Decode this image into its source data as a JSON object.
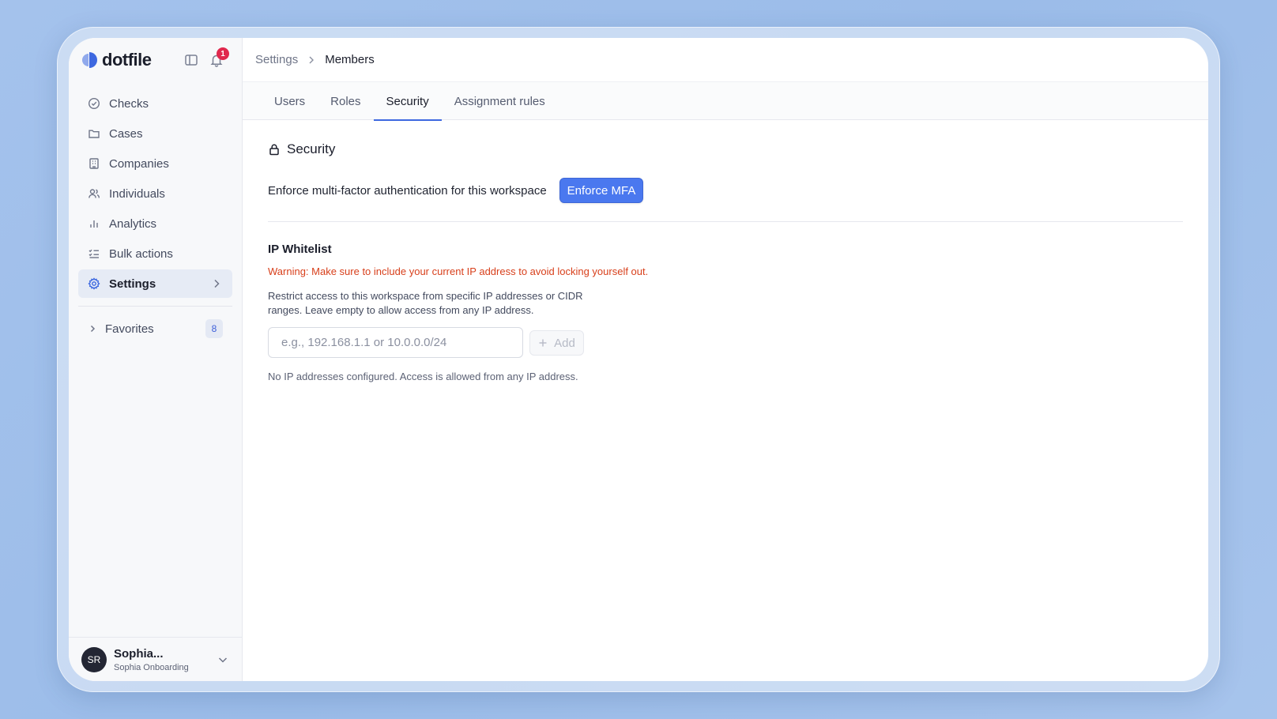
{
  "app": {
    "logo_text": "dotfile",
    "notification_count": "1",
    "accent_color": "#4a78ef"
  },
  "sidebar": {
    "items": [
      {
        "label": "Checks",
        "icon": "check-circle-icon"
      },
      {
        "label": "Cases",
        "icon": "folder-icon"
      },
      {
        "label": "Companies",
        "icon": "building-icon"
      },
      {
        "label": "Individuals",
        "icon": "users-icon"
      },
      {
        "label": "Analytics",
        "icon": "bar-chart-icon"
      },
      {
        "label": "Bulk actions",
        "icon": "list-checks-icon"
      },
      {
        "label": "Settings",
        "icon": "gear-icon",
        "active": true
      }
    ],
    "favorites": {
      "label": "Favorites",
      "count": "8"
    }
  },
  "user": {
    "initials": "SR",
    "name": "Sophia...",
    "org": "Sophia Onboarding"
  },
  "breadcrumb": {
    "parent": "Settings",
    "current": "Members"
  },
  "tabs": [
    {
      "label": "Users"
    },
    {
      "label": "Roles"
    },
    {
      "label": "Security",
      "active": true
    },
    {
      "label": "Assignment rules"
    }
  ],
  "security": {
    "title": "Security",
    "mfa_text": "Enforce multi-factor authentication for this workspace",
    "mfa_button": "Enforce MFA"
  },
  "ip_whitelist": {
    "title": "IP Whitelist",
    "warning": "Warning: Make sure to include your current IP address to avoid locking yourself out.",
    "description": "Restrict access to this workspace from specific IP addresses or CIDR ranges. Leave empty to allow access from any IP address.",
    "input_placeholder": "e.g., 192.168.1.1 or 10.0.0.0/24",
    "input_value": "",
    "add_button": "Add",
    "empty_note": "No IP addresses configured. Access is allowed from any IP address."
  }
}
